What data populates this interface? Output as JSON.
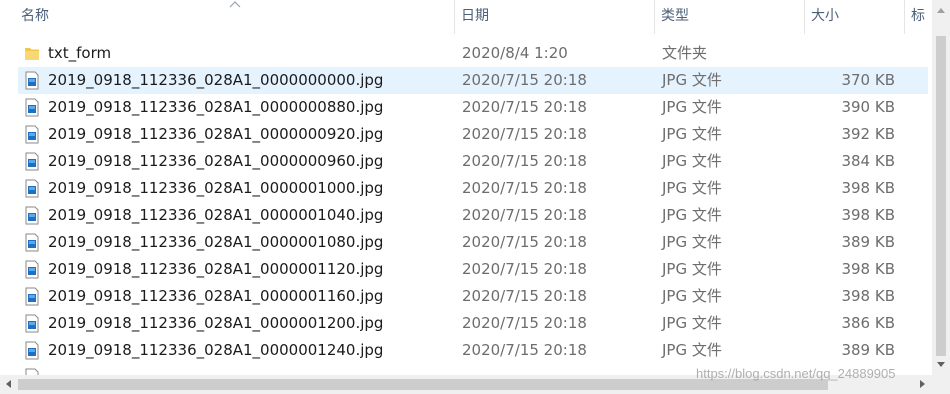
{
  "columns": {
    "name": "名称",
    "date": "日期",
    "type": "类型",
    "size": "大小",
    "tag": "标"
  },
  "rows": [
    {
      "name": "txt_form",
      "date": "2020/8/4 1:20",
      "type": "文件夹",
      "size": "",
      "icon": "folder-icon"
    },
    {
      "name": "2019_0918_112336_028A1_0000000000.jpg",
      "date": "2020/7/15 20:18",
      "type": "JPG 文件",
      "size": "370 KB",
      "icon": "jpg-file-icon"
    },
    {
      "name": "2019_0918_112336_028A1_0000000880.jpg",
      "date": "2020/7/15 20:18",
      "type": "JPG 文件",
      "size": "390 KB",
      "icon": "jpg-file-icon"
    },
    {
      "name": "2019_0918_112336_028A1_0000000920.jpg",
      "date": "2020/7/15 20:18",
      "type": "JPG 文件",
      "size": "392 KB",
      "icon": "jpg-file-icon"
    },
    {
      "name": "2019_0918_112336_028A1_0000000960.jpg",
      "date": "2020/7/15 20:18",
      "type": "JPG 文件",
      "size": "384 KB",
      "icon": "jpg-file-icon"
    },
    {
      "name": "2019_0918_112336_028A1_0000001000.jpg",
      "date": "2020/7/15 20:18",
      "type": "JPG 文件",
      "size": "398 KB",
      "icon": "jpg-file-icon"
    },
    {
      "name": "2019_0918_112336_028A1_0000001040.jpg",
      "date": "2020/7/15 20:18",
      "type": "JPG 文件",
      "size": "398 KB",
      "icon": "jpg-file-icon"
    },
    {
      "name": "2019_0918_112336_028A1_0000001080.jpg",
      "date": "2020/7/15 20:18",
      "type": "JPG 文件",
      "size": "389 KB",
      "icon": "jpg-file-icon"
    },
    {
      "name": "2019_0918_112336_028A1_0000001120.jpg",
      "date": "2020/7/15 20:18",
      "type": "JPG 文件",
      "size": "398 KB",
      "icon": "jpg-file-icon"
    },
    {
      "name": "2019_0918_112336_028A1_0000001160.jpg",
      "date": "2020/7/15 20:18",
      "type": "JPG 文件",
      "size": "398 KB",
      "icon": "jpg-file-icon"
    },
    {
      "name": "2019_0918_112336_028A1_0000001200.jpg",
      "date": "2020/7/15 20:18",
      "type": "JPG 文件",
      "size": "386 KB",
      "icon": "jpg-file-icon"
    },
    {
      "name": "2019_0918_112336_028A1_0000001240.jpg",
      "date": "2020/7/15 20:18",
      "type": "JPG 文件",
      "size": "389 KB",
      "icon": "jpg-file-icon"
    }
  ],
  "watermark": "https://blog.csdn.net/qq_24889905",
  "colors": {
    "selected_row": "#e5f3ff",
    "folder": "#f2c84b",
    "header_text": "#4c607a"
  }
}
